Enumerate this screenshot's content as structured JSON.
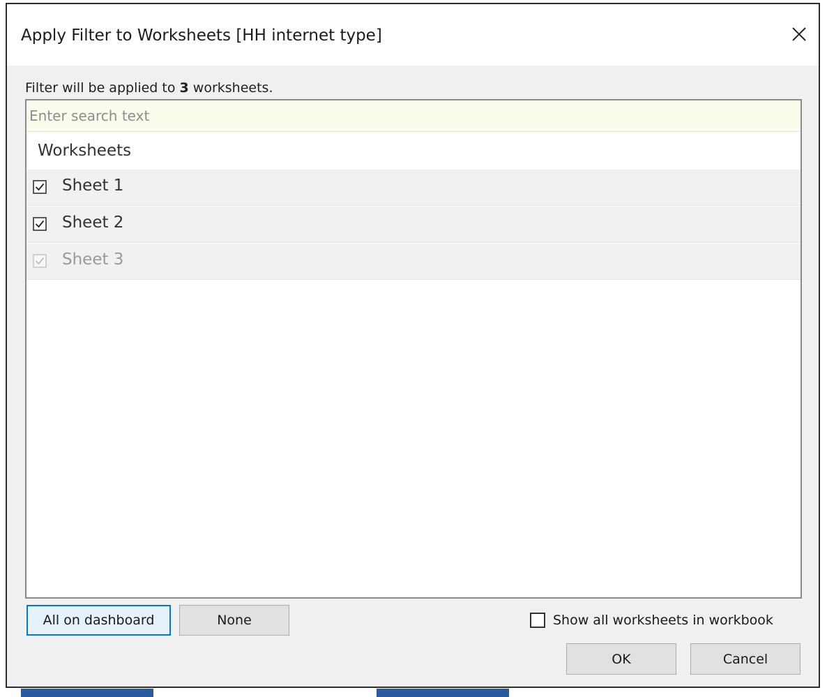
{
  "dialog": {
    "title": "Apply Filter to Worksheets [HH internet type]",
    "info_prefix": "Filter will be applied to ",
    "info_count": "3",
    "info_suffix": " worksheets."
  },
  "search": {
    "placeholder": "Enter search text",
    "value": ""
  },
  "list": {
    "header": "Worksheets",
    "items": [
      {
        "label": "Sheet 1",
        "checked": true,
        "enabled": true
      },
      {
        "label": "Sheet 2",
        "checked": true,
        "enabled": true
      },
      {
        "label": "Sheet 3",
        "checked": true,
        "enabled": false
      }
    ]
  },
  "buttons": {
    "all_on_dashboard": "All on dashboard",
    "none": "None",
    "ok": "OK",
    "cancel": "Cancel"
  },
  "options": {
    "show_all_label": "Show all worksheets in workbook",
    "show_all_checked": false
  },
  "colors": {
    "accent": "#0078d7",
    "search_bg": "#fcfcec",
    "dialog_bg": "#f0f0f0"
  },
  "icons": [
    "close-icon",
    "checkbox-checked-icon",
    "checkbox-checked-disabled-icon",
    "checkbox-empty-icon"
  ]
}
